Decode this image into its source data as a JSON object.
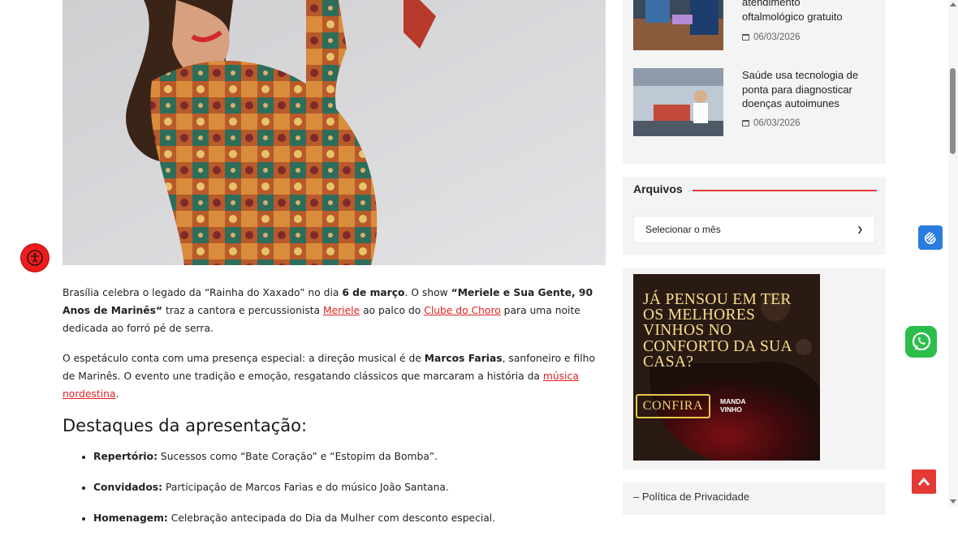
{
  "article": {
    "p1": {
      "t1": "Brasília celebra o legado da “Rainha do Xaxado” no dia ",
      "b1": "6 de março",
      "t2": ". O show ",
      "b2": "“Meriele e Sua Gente, 90 Anos de Marinês“",
      "t3": " traz a cantora e percussionista ",
      "link1": "Meriele",
      "t4": " ao palco do ",
      "link2": "Clube do Choro",
      "t5": " para uma noite dedicada ao forró pé de serra."
    },
    "p2": {
      "t1": "O espetáculo conta com uma presença especial: a direção musical é de ",
      "b1": "Marcos Farias",
      "t2": ", sanfoneiro e filho de Marinês. O evento une tradição e emoção, resgatando clássicos que marcaram a história da ",
      "link1": "música nordestina",
      "t3": "."
    },
    "heading": "Destaques da apresentação:",
    "bullets": [
      {
        "label": "Repertório:",
        "text": " Sucessos como “Bate Coração” e “Estopim da Bomba”."
      },
      {
        "label": "Convidados:",
        "text": " Participação de Marcos Farias e do músico João Santana."
      },
      {
        "label": "Homenagem:",
        "text": " Celebração antecipada do Dia da Mulher com desconto especial."
      }
    ]
  },
  "sidebar": {
    "posts": [
      {
        "title": "atendimento oftalmológico gratuito",
        "date": "06/03/2026"
      },
      {
        "title": "Saúde usa tecnologia de ponta para diagnosticar doenças autoimunes",
        "date": "06/03/2026"
      }
    ],
    "archives": {
      "title": "Arquivos",
      "select_value": "Selecionar o mês"
    },
    "ad": {
      "headline": "JÁ PENSOU EM TER OS MELHORES VINHOS NO CONFORTO DA SUA CASA?",
      "cta": "CONFIRA",
      "brand_line1": "MANDA",
      "brand_line2": "VINHO"
    },
    "footer_link": "– Política de Privacidade"
  },
  "colors": {
    "accent": "#e53935",
    "link": "#e02020",
    "whatsapp": "#2cbe4b",
    "libras": "#2b7ce0"
  },
  "icons": [
    "accessibility-icon",
    "calendar-icon",
    "chevron-down-icon",
    "sign-language-icon",
    "whatsapp-icon",
    "arrow-up-icon"
  ]
}
